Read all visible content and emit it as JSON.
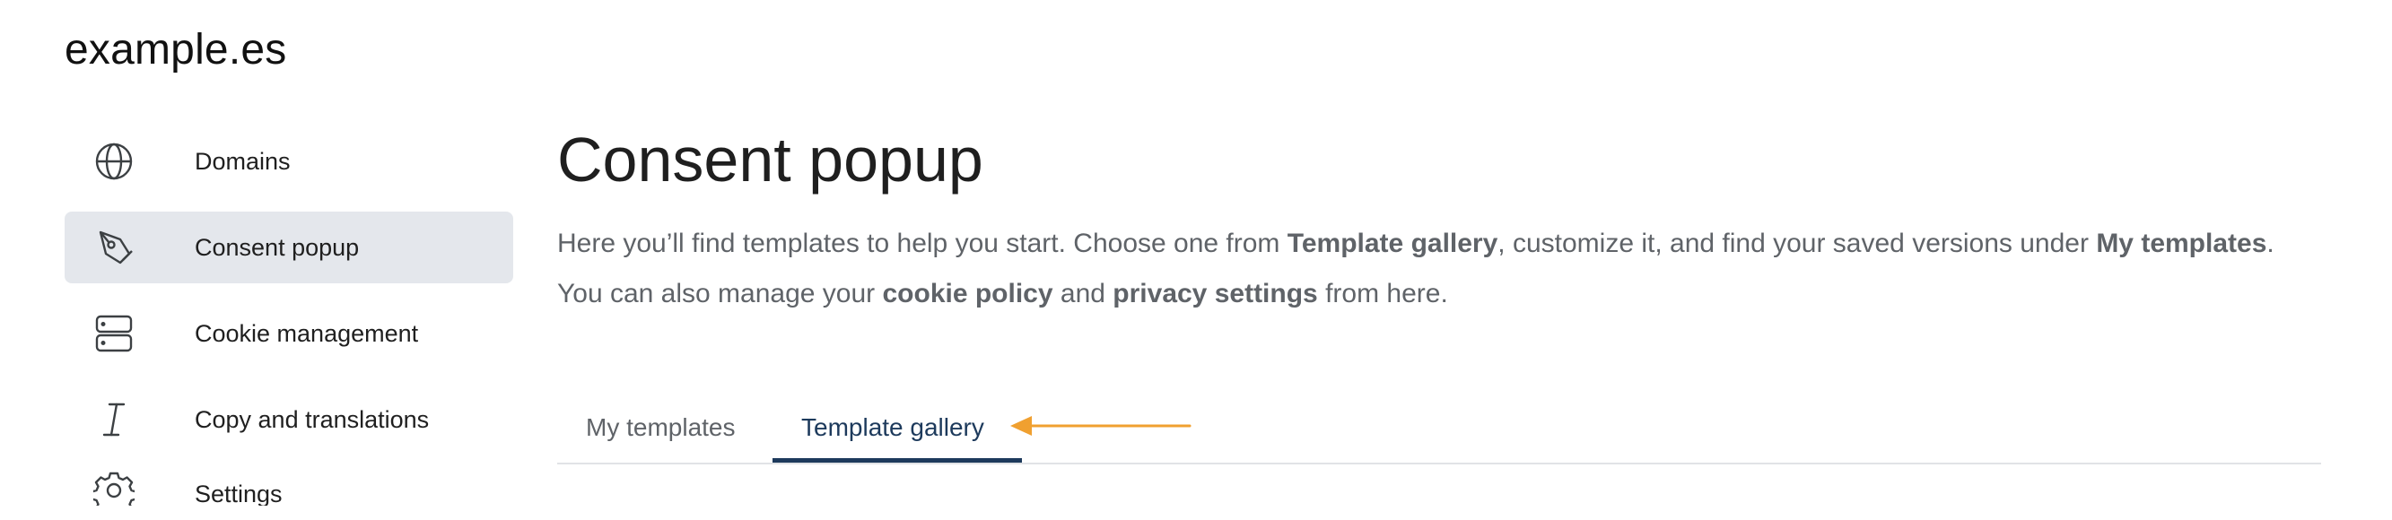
{
  "site": {
    "title": "example.es"
  },
  "sidebar": {
    "items": [
      {
        "label": "Domains",
        "icon": "globe-icon",
        "active": false
      },
      {
        "label": "Consent popup",
        "icon": "pen-tool-icon",
        "active": true
      },
      {
        "label": "Cookie management",
        "icon": "server-icon",
        "active": false
      },
      {
        "label": "Copy and translations",
        "icon": "italic-icon",
        "active": false
      },
      {
        "label": "Settings",
        "icon": "gear-icon",
        "active": false
      }
    ]
  },
  "main": {
    "title": "Consent popup",
    "description": {
      "t1": "Here you’ll find templates to help you start. Choose one from ",
      "b1": "Template gallery",
      "t2": ", customize it, and find your saved versions under ",
      "b2": "My templates",
      "t3": ". You can also manage your ",
      "b3": "cookie policy",
      "t4": " and ",
      "b4": "privacy settings",
      "t5": " from here."
    },
    "tabs": [
      {
        "label": "My templates",
        "active": false
      },
      {
        "label": "Template gallery",
        "active": true
      }
    ]
  },
  "colors": {
    "active_nav_bg": "#e4e7ec",
    "active_tab": "#1d3a5c",
    "annotation_arrow": "#f0a030"
  }
}
